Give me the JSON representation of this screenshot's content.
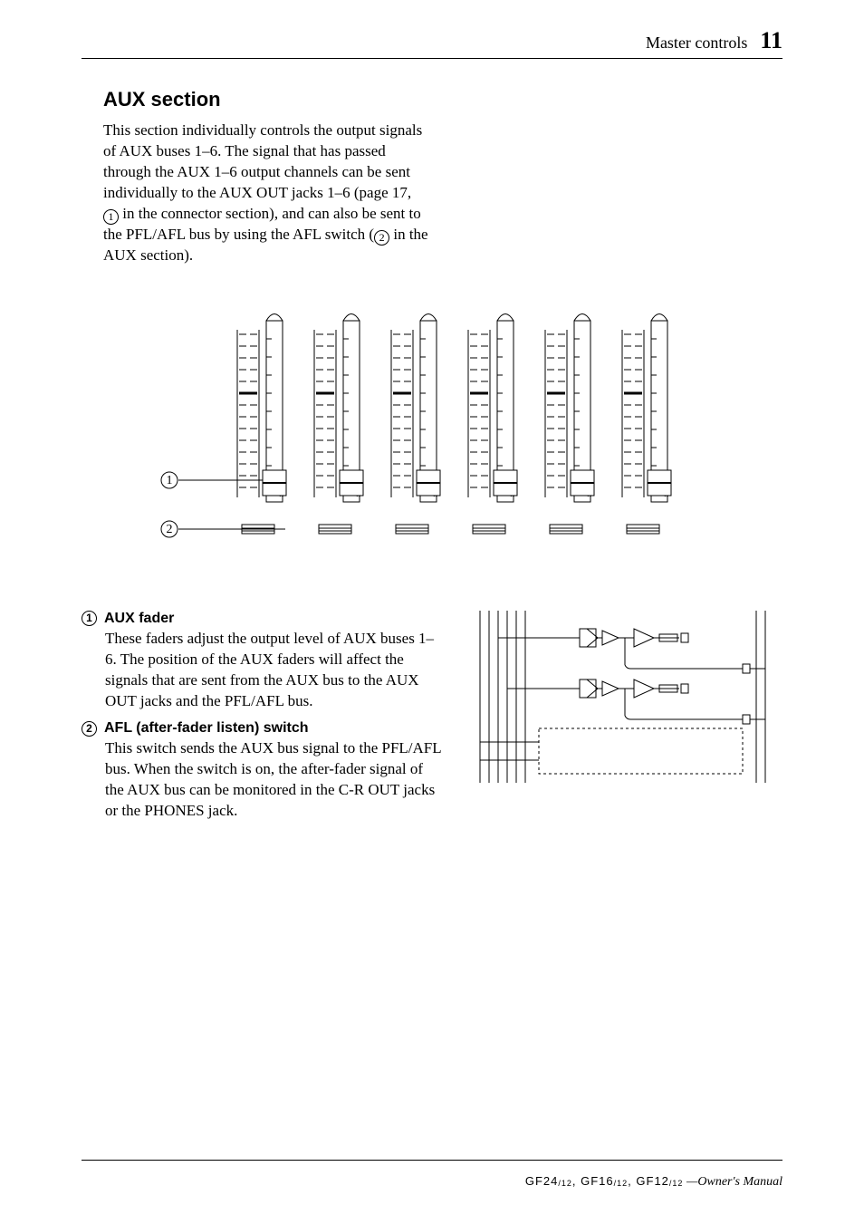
{
  "header": {
    "section": "Master controls",
    "page": "11"
  },
  "section": {
    "title": "AUX section",
    "intro_part1": "This section individually controls the output signals of AUX buses 1–6. The signal that has passed through the AUX 1–6 output channels can be sent individually to the AUX OUT jacks 1–6 (page 17, ",
    "intro_ref1": "1",
    "intro_part2": " in the connector section), and can also be sent to the PFL/AFL bus by using the AFL switch (",
    "intro_ref2": "2",
    "intro_part3": " in the AUX section)."
  },
  "callouts": {
    "c1": "1",
    "c2": "2"
  },
  "items": [
    {
      "num": "1",
      "title": "AUX fader",
      "body": "These faders adjust the output level of AUX buses 1–6. The position of the AUX faders will affect the signals that are sent from the AUX bus to the AUX OUT jacks and the PFL/AFL bus."
    },
    {
      "num": "2",
      "title": "AFL (after-fader listen) switch",
      "body": "This switch sends the AUX bus signal to the PFL/AFL bus. When the switch is on, the after-fader signal of the AUX bus can be monitored in the C-R OUT jacks or the PHONES jack."
    }
  ],
  "footer": {
    "models": "GF24/12, GF16/12, GF12/12",
    "label": "—Owner's Manual"
  }
}
